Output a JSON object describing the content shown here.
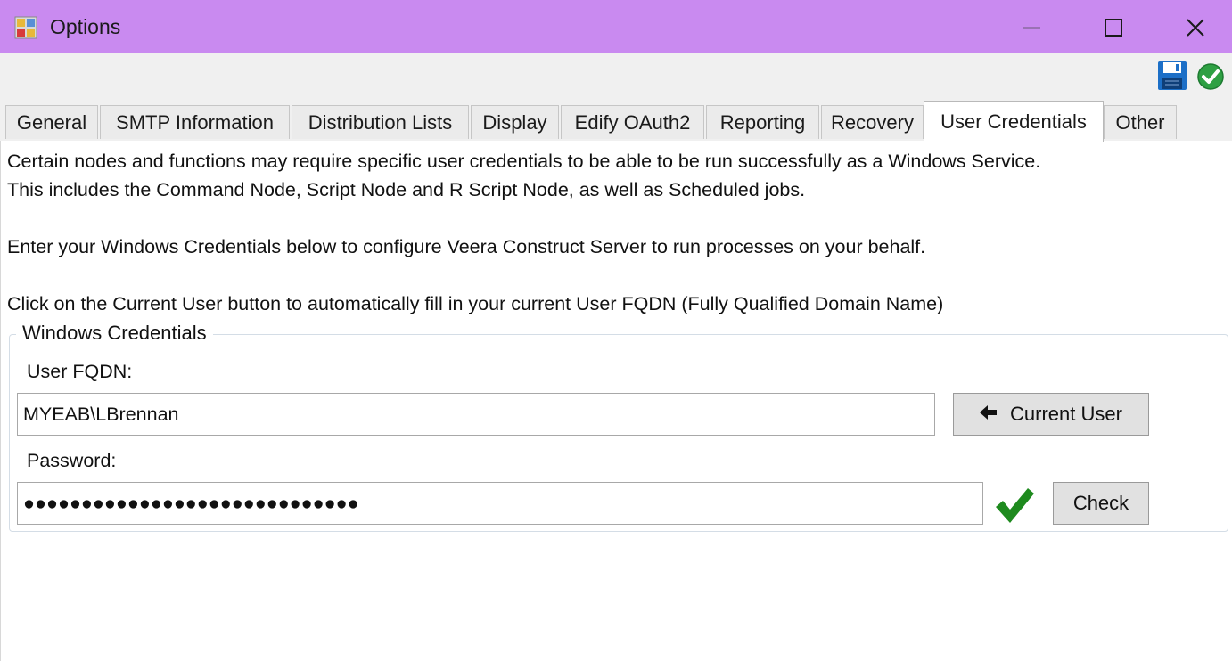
{
  "window": {
    "title": "Options",
    "icon": "options-app-icon"
  },
  "window_controls": {
    "minimize": "minimize-icon",
    "maximize": "maximize-icon",
    "close": "close-icon"
  },
  "toolbar": {
    "save_icon": "floppy-disk-icon",
    "apply_icon": "green-check-circle-icon"
  },
  "tabs": [
    {
      "label": "General"
    },
    {
      "label": "SMTP Information"
    },
    {
      "label": "Distribution Lists"
    },
    {
      "label": "Display"
    },
    {
      "label": "Edify OAuth2"
    },
    {
      "label": "Reporting"
    },
    {
      "label": "Recovery"
    },
    {
      "label": "User Credentials"
    },
    {
      "label": "Other"
    }
  ],
  "active_tab": "User Credentials",
  "content": {
    "line1": "Certain nodes and functions may require specific user credentials to be able to be run successfully as a Windows Service.",
    "line2": "This includes the Command Node, Script Node and R Script Node, as well as Scheduled jobs.",
    "line3": "Enter your Windows Credentials below to configure Veera Construct Server to run processes on your behalf.",
    "line4": "Click on the Current User button to automatically fill in your current User FQDN (Fully Qualified Domain Name)"
  },
  "credentials": {
    "group_label": "Windows Credentials",
    "fqdn_label": "User FQDN:",
    "fqdn_value": "MYEAB\\LBrennan",
    "current_user_button": "Current User",
    "password_label": "Password:",
    "password_value": "●●●●●●●●●●●●●●●●●●●●●●●●●●●●●",
    "check_button": "Check",
    "check_status_icon": "green-checkmark-icon"
  },
  "colors": {
    "titlebar": "#c98af0",
    "toolbar": "#f0f0f0",
    "tab_inactive": "#ebebeb",
    "button": "#e1e1e1",
    "check_green": "#1e8a1e",
    "save_blue": "#1c6fc7"
  }
}
